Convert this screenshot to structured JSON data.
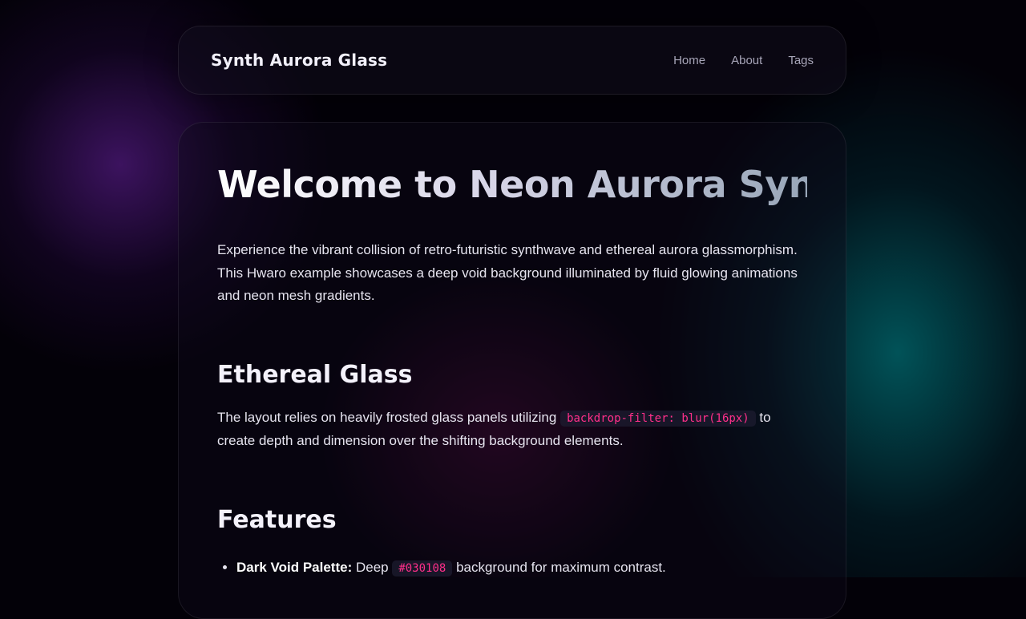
{
  "nav": {
    "brand": "Synth Aurora Glass",
    "links": [
      "Home",
      "About",
      "Tags"
    ]
  },
  "hero": {
    "title": "Welcome to Neon Aurora Synth",
    "intro": "Experience the vibrant collision of retro-futuristic synthwave and ethereal aurora glassmorphism. This Hwaro example showcases a deep void background illuminated by fluid glowing animations and neon mesh gradients."
  },
  "section_glass": {
    "heading": "Ethereal Glass",
    "text_before": "The layout relies on heavily frosted glass panels utilizing ",
    "code": "backdrop-filter: blur(16px)",
    "text_after": " to create depth and dimension over the shifting background elements."
  },
  "section_features": {
    "heading": "Features",
    "items": [
      {
        "label": "Dark Void Palette:",
        "text_before": " Deep ",
        "code": "#030108",
        "text_after": " background for maximum contrast."
      }
    ]
  },
  "colors": {
    "background": "#030108",
    "accent_code": "#ff2f8a",
    "aurora_purple": "#46166e",
    "aurora_teal": "#006e73"
  }
}
